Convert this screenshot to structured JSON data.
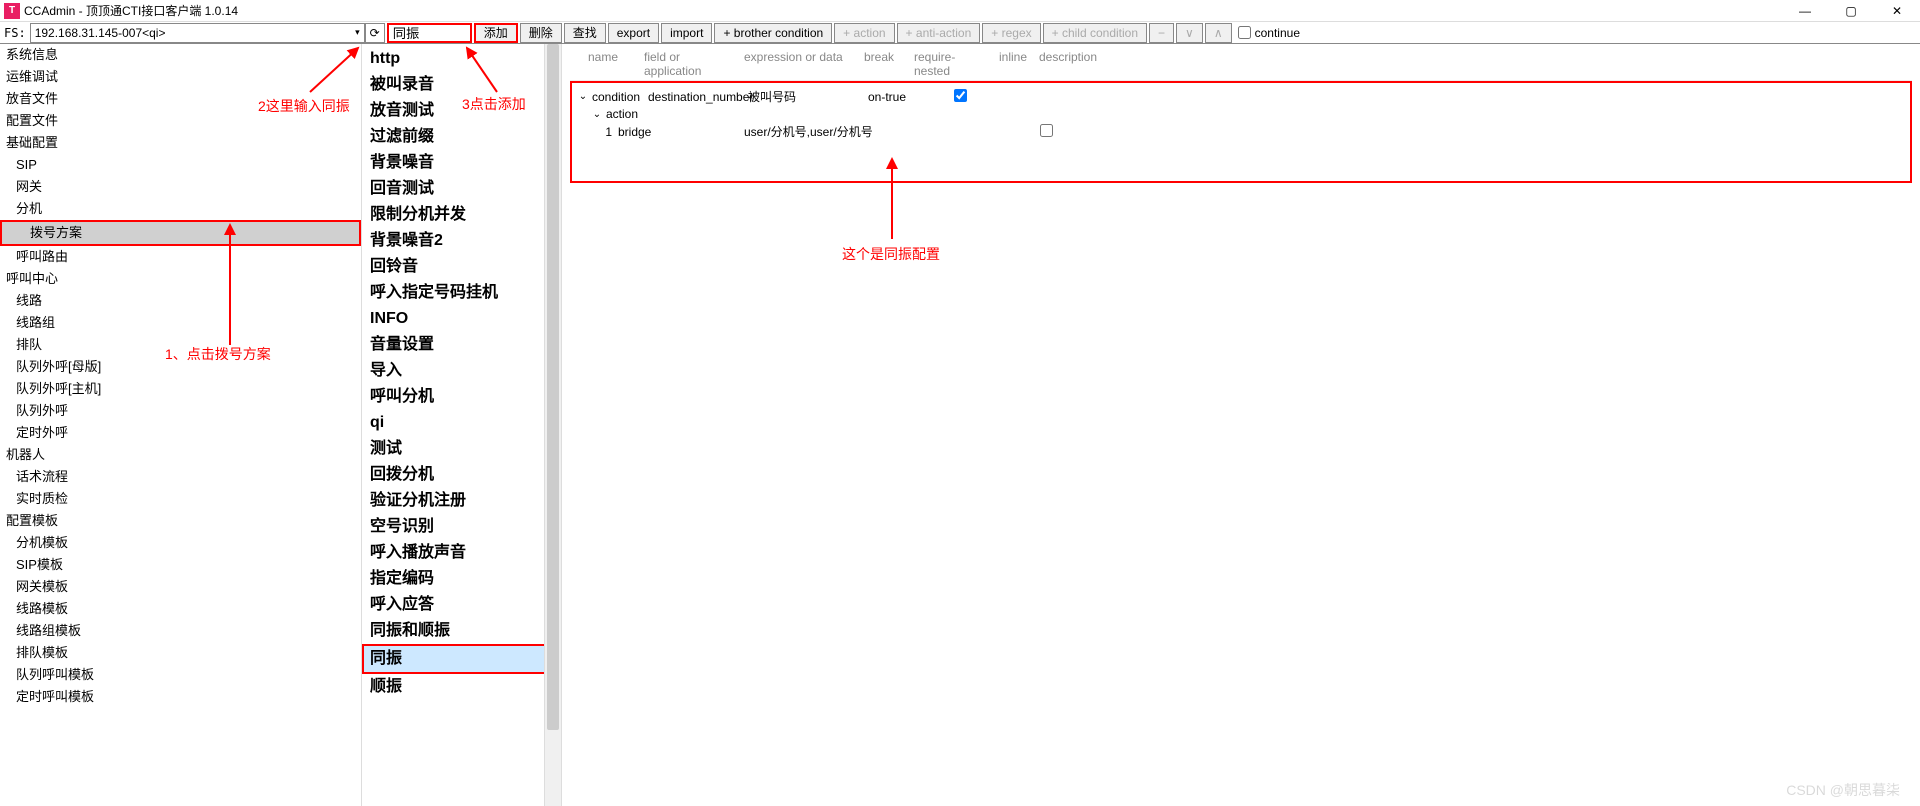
{
  "titlebar": {
    "app_icon_letter": "T",
    "title": "CCAdmin - 顶顶通CTI接口客户端  1.0.14"
  },
  "winbtns": {
    "min": "—",
    "max": "▢",
    "close": "✕"
  },
  "fsbar": {
    "label": "FS:",
    "combo_value": "192.168.31.145-007<qi>",
    "refresh_icon": "⟳",
    "search_value": "同振",
    "btn_add": "添加",
    "btn_delete": "删除",
    "btn_find": "查找",
    "btn_export": "export",
    "btn_import": "import",
    "btn_bro": "+ brother condition",
    "btn_action": "+ action",
    "btn_anti": "+ anti-action",
    "btn_regex": "+ regex",
    "btn_child": "+ child condition",
    "btn_minus": "−",
    "btn_up": "∧",
    "btn_down": "∨",
    "continue_label": "continue"
  },
  "tree": [
    {
      "label": "系统信息",
      "level": 0
    },
    {
      "label": "运维调试",
      "level": 0
    },
    {
      "label": "放音文件",
      "level": 0
    },
    {
      "label": "配置文件",
      "level": 0
    },
    {
      "label": "基础配置",
      "level": 0
    },
    {
      "label": "SIP",
      "level": 1
    },
    {
      "label": "网关",
      "level": 1
    },
    {
      "label": "分机",
      "level": 1
    },
    {
      "label": "拨号方案",
      "level": 1,
      "selected": true
    },
    {
      "label": "呼叫路由",
      "level": 1
    },
    {
      "label": "呼叫中心",
      "level": 0
    },
    {
      "label": "线路",
      "level": 1
    },
    {
      "label": "线路组",
      "level": 1
    },
    {
      "label": "排队",
      "level": 1
    },
    {
      "label": "队列外呼[母版]",
      "level": 1
    },
    {
      "label": "队列外呼[主机]",
      "level": 1
    },
    {
      "label": "队列外呼",
      "level": 1
    },
    {
      "label": "定时外呼",
      "level": 1
    },
    {
      "label": "机器人",
      "level": 0
    },
    {
      "label": "话术流程",
      "level": 1
    },
    {
      "label": "实时质检",
      "level": 1
    },
    {
      "label": "配置模板",
      "level": 0
    },
    {
      "label": "分机模板",
      "level": 1
    },
    {
      "label": "SIP模板",
      "level": 1
    },
    {
      "label": "网关模板",
      "level": 1
    },
    {
      "label": "线路模板",
      "level": 1
    },
    {
      "label": "线路组模板",
      "level": 1
    },
    {
      "label": "排队模板",
      "level": 1
    },
    {
      "label": "队列呼叫模板",
      "level": 1
    },
    {
      "label": "定时呼叫模板",
      "level": 1
    }
  ],
  "midlist": [
    "http",
    "被叫录音",
    "放音测试",
    "过滤前缀",
    "背景噪音",
    "回音测试",
    "限制分机并发",
    "背景噪音2",
    "回铃音",
    "呼入指定号码挂机",
    "INFO",
    "音量设置",
    "导入",
    "呼叫分机",
    "qi",
    "测试",
    "回拨分机",
    "验证分机注册",
    "空号识别",
    "呼入播放声音",
    "指定编码",
    "呼入应答",
    "同振和顺振",
    "同振",
    "顺振"
  ],
  "mid_selected_index": 23,
  "cols": {
    "name": "name",
    "field": "field or application",
    "expr": "expression or data",
    "break": "break",
    "req": "require-nested",
    "inline": "inline",
    "desc": "description"
  },
  "cond": {
    "label": "condition",
    "field": "destination_number",
    "expr": "被叫号码",
    "break": "on-true"
  },
  "action_label": "action",
  "bridge": {
    "idx": "1",
    "name": "bridge",
    "expr": "user/分机号,user/分机号"
  },
  "annotations": {
    "a1": "1、点击拨号方案",
    "a2": "2这里输入同振",
    "a3": "3点击添加",
    "a4": "这个是同振配置"
  },
  "watermark": "CSDN @朝思暮柒"
}
